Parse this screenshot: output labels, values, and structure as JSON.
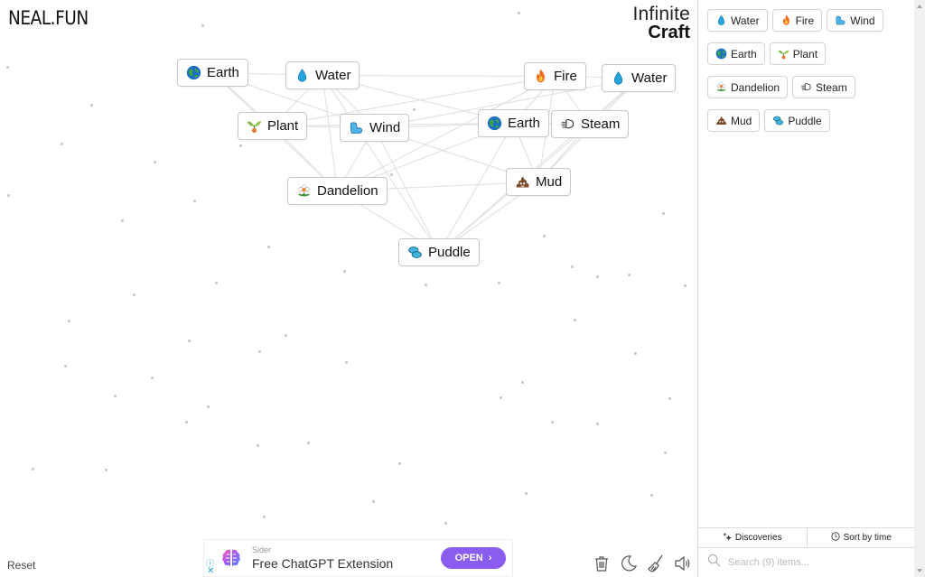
{
  "header": {
    "logo": "NEAL.FUN",
    "title_line1": "Infinite",
    "title_line2": "Craft"
  },
  "canvas": {
    "nodes": [
      {
        "label": "Earth",
        "icon": "earth-globe-icon"
      },
      {
        "label": "Water",
        "icon": "water-drop-icon"
      },
      {
        "label": "Fire",
        "icon": "fire-icon"
      },
      {
        "label": "Water",
        "icon": "water-drop-icon"
      },
      {
        "label": "Plant",
        "icon": "seedling-icon"
      },
      {
        "label": "Wind",
        "icon": "wind-icon"
      },
      {
        "label": "Earth",
        "icon": "earth-globe-icon"
      },
      {
        "label": "Steam",
        "icon": "steam-puff-icon"
      },
      {
        "label": "Dandelion",
        "icon": "flower-icon"
      },
      {
        "label": "Mud",
        "icon": "mud-icon"
      },
      {
        "label": "Puddle",
        "icon": "puddle-icon"
      }
    ]
  },
  "footer": {
    "reset_label": "Reset",
    "tools": [
      "trash-icon",
      "dark-mode-icon",
      "broom-icon",
      "sound-icon"
    ]
  },
  "ad": {
    "sponsor": "Sider",
    "headline": "Free ChatGPT Extension",
    "cta_label": "OPEN",
    "info_glyph": "ⓘ",
    "close_glyph": "✕"
  },
  "sidebar": {
    "items": [
      {
        "label": "Water",
        "icon": "water-drop-icon"
      },
      {
        "label": "Fire",
        "icon": "fire-icon"
      },
      {
        "label": "Wind",
        "icon": "wind-icon"
      },
      {
        "label": "Earth",
        "icon": "earth-globe-icon"
      },
      {
        "label": "Plant",
        "icon": "seedling-icon"
      },
      {
        "label": "Dandelion",
        "icon": "flower-icon"
      },
      {
        "label": "Steam",
        "icon": "steam-puff-icon"
      },
      {
        "label": "Mud",
        "icon": "mud-icon"
      },
      {
        "label": "Puddle",
        "icon": "puddle-icon"
      }
    ],
    "discoveries_label": "Discoveries",
    "sort_label": "Sort by time",
    "search_placeholder": "Search (9) items..."
  },
  "colors": {
    "accent": "#8a5cf0",
    "border": "#c8c8c8",
    "link_blue": "#2a9fd8"
  }
}
